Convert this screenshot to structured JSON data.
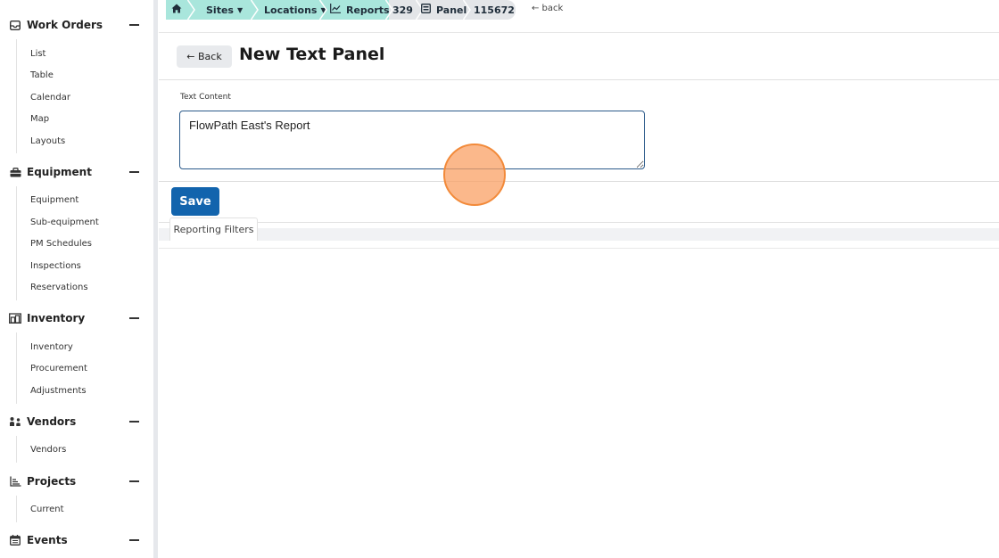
{
  "sidebar": {
    "sections": [
      {
        "title": "Work Orders",
        "icon": "inbox-icon",
        "items": [
          "List",
          "Table",
          "Calendar",
          "Map",
          "Layouts"
        ]
      },
      {
        "title": "Equipment",
        "icon": "equipment-icon",
        "items": [
          "Equipment",
          "Sub-equipment",
          "PM Schedules",
          "Inspections",
          "Reservations"
        ]
      },
      {
        "title": "Inventory",
        "icon": "inventory-icon",
        "items": [
          "Inventory",
          "Procurement",
          "Adjustments"
        ]
      },
      {
        "title": "Vendors",
        "icon": "vendors-icon",
        "items": [
          "Vendors"
        ]
      },
      {
        "title": "Projects",
        "icon": "projects-icon",
        "items": [
          "Current"
        ]
      },
      {
        "title": "Events",
        "icon": "calendar-icon",
        "items": []
      }
    ]
  },
  "breadcrumb": {
    "sites": "Sites",
    "locations": "Locations",
    "reports": "Reports",
    "report_id": "329",
    "panel": "Panel",
    "panel_id": "115672",
    "back": "← back"
  },
  "header": {
    "back_label": "← Back",
    "title": "New Text Panel"
  },
  "form": {
    "text_content_label": "Text Content",
    "text_content_value": "FlowPath East's Report",
    "save_label": "Save"
  },
  "filters": {
    "tab_label": "Reporting Filters"
  },
  "colors": {
    "accent": "#1264ad",
    "breadcrumb_teal": "#a9e6dc",
    "click_marker": "#f28a3a"
  }
}
